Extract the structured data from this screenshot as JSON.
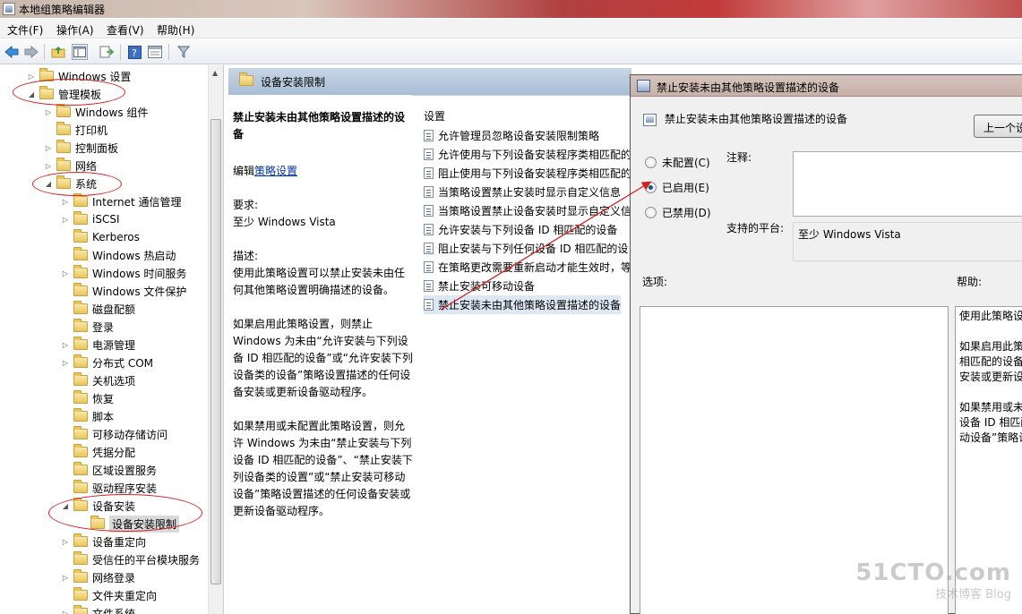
{
  "window": {
    "title": "本地组策略编辑器"
  },
  "menubar": [
    {
      "label": "文件(F)"
    },
    {
      "label": "操作(A)"
    },
    {
      "label": "查看(V)"
    },
    {
      "label": "帮助(H)"
    }
  ],
  "tree": {
    "items": [
      {
        "label": "Windows 设置",
        "arrow": "▷"
      },
      {
        "label": "管理模板",
        "arrow": "◢"
      },
      {
        "label": "Windows 组件",
        "arrow": "▷"
      },
      {
        "label": "打印机",
        "arrow": ""
      },
      {
        "label": "控制面板",
        "arrow": "▷"
      },
      {
        "label": "网络",
        "arrow": "▷"
      },
      {
        "label": "系统",
        "arrow": "◢"
      },
      {
        "label": "Internet 通信管理",
        "arrow": "▷"
      },
      {
        "label": "iSCSI",
        "arrow": "▷"
      },
      {
        "label": "Kerberos",
        "arrow": ""
      },
      {
        "label": "Windows 热启动",
        "arrow": ""
      },
      {
        "label": "Windows 时间服务",
        "arrow": "▷"
      },
      {
        "label": "Windows 文件保护",
        "arrow": ""
      },
      {
        "label": "磁盘配额",
        "arrow": ""
      },
      {
        "label": "登录",
        "arrow": ""
      },
      {
        "label": "电源管理",
        "arrow": "▷"
      },
      {
        "label": "分布式 COM",
        "arrow": "▷"
      },
      {
        "label": "关机选项",
        "arrow": ""
      },
      {
        "label": "恢复",
        "arrow": ""
      },
      {
        "label": "脚本",
        "arrow": ""
      },
      {
        "label": "可移动存储访问",
        "arrow": ""
      },
      {
        "label": "凭据分配",
        "arrow": ""
      },
      {
        "label": "区域设置服务",
        "arrow": ""
      },
      {
        "label": "驱动程序安装",
        "arrow": ""
      },
      {
        "label": "设备安装",
        "arrow": "◢"
      },
      {
        "label": "设备安装限制",
        "arrow": ""
      },
      {
        "label": "设备重定向",
        "arrow": "▷"
      },
      {
        "label": "受信任的平台模块服务",
        "arrow": ""
      },
      {
        "label": "网络登录",
        "arrow": "▷"
      },
      {
        "label": "文件夹重定向",
        "arrow": ""
      },
      {
        "label": "文件系统",
        "arrow": "▷"
      }
    ]
  },
  "middle": {
    "header_title": "设备安装限制",
    "description": {
      "heading": "禁止安装未由其他策略设置描述的设备",
      "edit_prefix": "编辑",
      "edit_link": "策略设置",
      "requirements_label": "要求:",
      "requirements_value": "至少 Windows Vista",
      "desc_label": "描述:",
      "desc_p1": "使用此策略设置可以禁止安装未由任何其他策略设置明确描述的设备。",
      "desc_p2": "如果启用此策略设置，则禁止 Windows 为未由“允许安装与下列设备 ID 相匹配的设备”或“允许安装下列设备类的设备”策略设置描述的任何设备安装或更新设备驱动程序。",
      "desc_p3": "如果禁用或未配置此策略设置，则允许 Windows 为未由“禁止安装与下列设备 ID 相匹配的设备”、“禁止安装下列设备类的设置”或“禁止安装可移动设备”策略设置描述的任何设备安装或更新设备驱动程序。"
    },
    "settings": {
      "column_header": "设置",
      "items": [
        "允许管理员忽略设备安装限制策略",
        "允许使用与下列设备安装程序类相匹配的",
        "阻止使用与下列设备安装程序类相匹配的",
        "当策略设置禁止安装时显示自定义信息",
        "当策略设置禁止设备安装时显示自定义信",
        "允许安装与下列设备 ID 相匹配的设备",
        "阻止安装与下列任何设备 ID 相匹配的设",
        "在策略更改需要重新启动才能生效时，等",
        "禁止安装可移动设备",
        "禁止安装未由其他策略设置描述的设备"
      ]
    }
  },
  "dialog": {
    "title": "禁止安装未由其他策略设置描述的设备",
    "policy_name": "禁止安装未由其他策略设置描述的设备",
    "prev_button": "上一个设",
    "radio_not_configured": "未配置(C)",
    "radio_enabled": "已启用(E)",
    "radio_disabled": "已禁用(D)",
    "comment_label": "注释:",
    "platform_label": "支持的平台:",
    "platform_value": "至少 Windows Vista",
    "options_label": "选项:",
    "help_label": "帮助:",
    "help_lines": [
      "使用此策略设置可以禁止安装",
      "",
      "如果启用此策略设置，则禁止",
      "相匹配的设备”或“允许安装",
      "安装或更新设备驱动程序。",
      "",
      "如果禁用或未配置此策略设置",
      "设备 ID 相匹配的设备”、“禁止",
      "动设备”策略设置描述的任何设"
    ]
  },
  "watermark": {
    "line1": "51CTO.com",
    "line2": "技术博客   Blog"
  }
}
